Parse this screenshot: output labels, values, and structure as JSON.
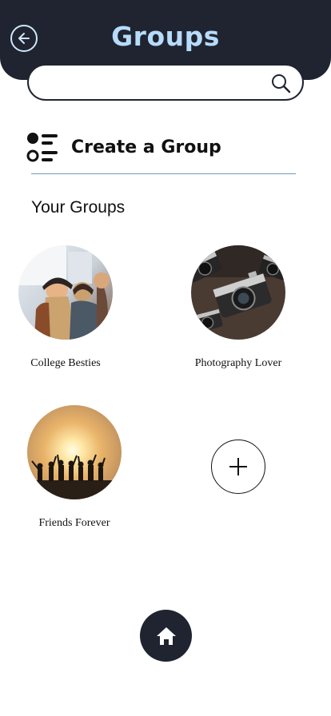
{
  "header": {
    "title": "Groups",
    "back_icon": "arrow-left-circle-icon",
    "background": "#1f2430",
    "title_color": "#b7dbfa"
  },
  "search": {
    "value": "",
    "placeholder": "",
    "icon": "search-icon"
  },
  "create_group": {
    "label": "Create a Group",
    "icon": "list-icon"
  },
  "your_groups": {
    "title": "Your Groups",
    "groups": [
      {
        "name": "College Besties",
        "image": "college-besties-photo"
      },
      {
        "name": "Photography Lover",
        "image": "photography-lover-photo"
      },
      {
        "name": "Friends Forever",
        "image": "friends-forever-photo"
      }
    ],
    "add_icon": "plus-icon"
  },
  "nav": {
    "home_icon": "home-icon"
  }
}
